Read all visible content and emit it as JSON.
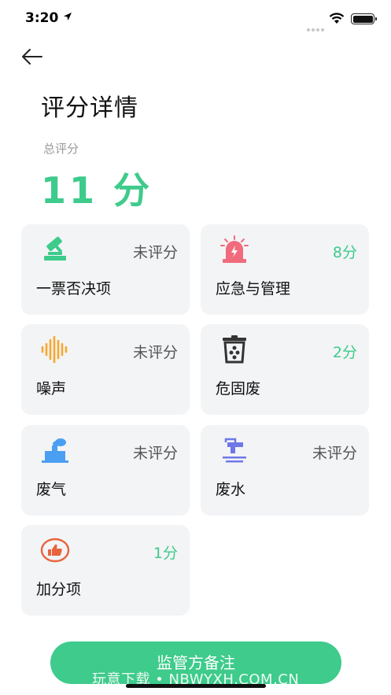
{
  "status_bar": {
    "time": "3:20"
  },
  "header": {
    "title": "评分详情"
  },
  "summary": {
    "label": "总评分",
    "value": "11 分"
  },
  "cards": [
    {
      "name": "一票否决项",
      "score": "未评分",
      "icon": "gavel-icon"
    },
    {
      "name": "应急与管理",
      "score": "8分",
      "icon": "alarm-siren-icon"
    },
    {
      "name": "噪声",
      "score": "未评分",
      "icon": "sound-wave-icon"
    },
    {
      "name": "危固废",
      "score": "2分",
      "icon": "waste-bin-icon"
    },
    {
      "name": "废气",
      "score": "未评分",
      "icon": "factory-smoke-icon"
    },
    {
      "name": "废水",
      "score": "未评分",
      "icon": "water-faucet-icon"
    },
    {
      "name": "加分项",
      "score": "1分",
      "icon": "thumbs-up-icon"
    }
  ],
  "footer": {
    "button_label": "监管方备注",
    "watermark": "玩意下载 • NBWYXH.COM.CN"
  },
  "colors": {
    "accent": "#3ecb8b",
    "card_bg": "#f3f4f6",
    "gavel": "#3ecb8b",
    "siren": "#f06b7c",
    "wave": "#f6a82e",
    "bin": "#333333",
    "factory": "#4b9ff2",
    "faucet": "#6f78e8",
    "thumb": "#e8643c"
  }
}
